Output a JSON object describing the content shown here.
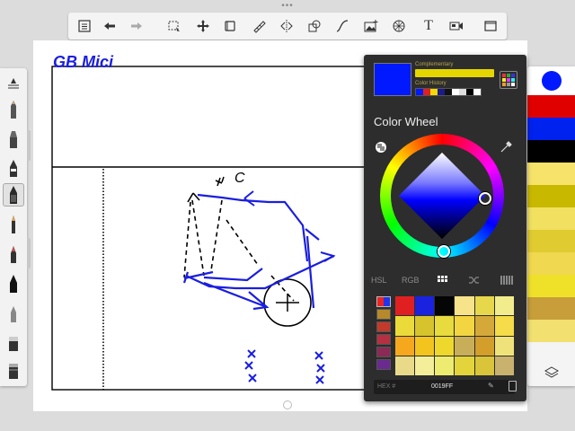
{
  "toolbar": {
    "icons": [
      "list-icon",
      "undo-icon",
      "redo-icon",
      "select-icon",
      "move-icon",
      "crop-icon",
      "ruler-icon",
      "symmetry-icon",
      "shape-icon",
      "curve-icon",
      "image-icon",
      "perspective-icon",
      "text-icon",
      "video-icon",
      "fullscreen-icon"
    ],
    "text_tool_label": "T"
  },
  "canvas": {
    "handwriting": "GB Mici",
    "letter_c": "C"
  },
  "color_panel": {
    "current_color": "#0019FF",
    "complementary_label": "Complementary",
    "complementary_color": "#E6D600",
    "history_label": "Color History",
    "history_colors": [
      "#0019FF",
      "#E02020",
      "#F5D800",
      "#1B1B8A",
      "#111111",
      "#FFFFFF",
      "#DDDDDD",
      "#000000",
      "#FFFFFF"
    ],
    "title": "Color Wheel",
    "modes": [
      "HSL",
      "RGB",
      "Palette"
    ],
    "active_mode": "Palette",
    "hex_label": "HEX #",
    "hex_value": "0019FF",
    "palette": [
      "#E02020",
      "#1A22E0",
      "#050505",
      "#F7E38A",
      "#E6D84A",
      "#F2EC8C",
      "#EADB3A",
      "#D7C42C",
      "#E7DB3E",
      "#F2D540",
      "#D4A93A",
      "#F5DC48",
      "#F5A81E",
      "#F3C41E",
      "#EED82C",
      "#C9AE5A",
      "#D39E2A",
      "#F0E27A",
      "#E9DA8A",
      "#F4EE9A",
      "#EDEB70",
      "#E2D43A",
      "#D9C43A",
      "#C8B26E"
    ]
  },
  "swatchbar": {
    "current": "#0019FF",
    "strips": [
      "#E00000",
      "#0022EE",
      "#000000",
      "#F7E36A",
      "#C9B800",
      "#F2E060",
      "#E0CC30",
      "#F0D850",
      "#EFE12A",
      "#C79E3A",
      "#F2E070"
    ]
  }
}
